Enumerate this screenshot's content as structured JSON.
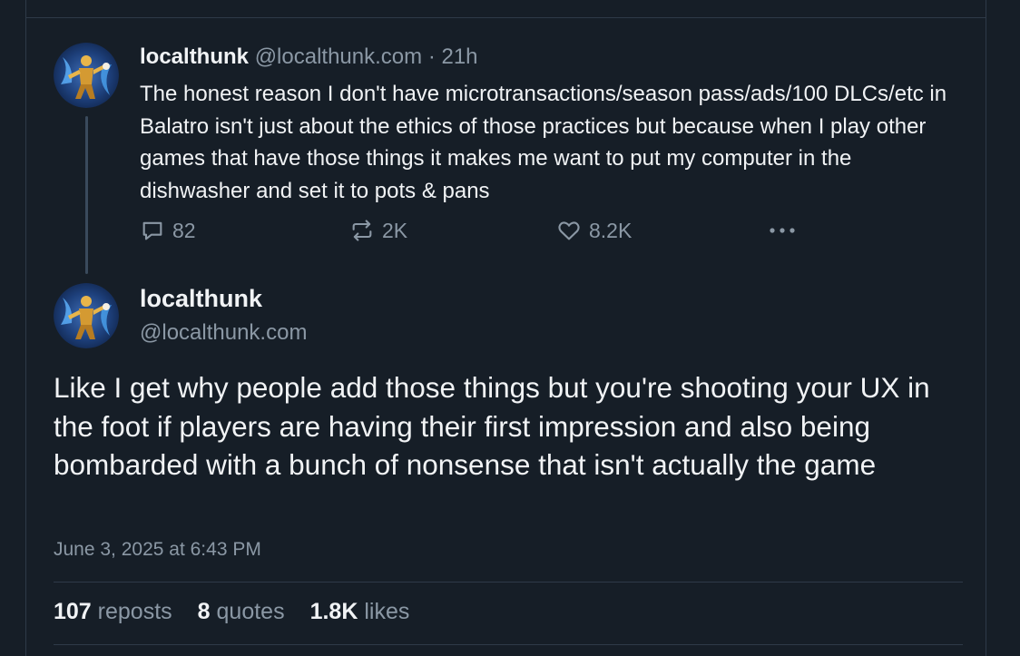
{
  "parent_post": {
    "author_name": "localthunk",
    "author_handle": "@localthunk.com",
    "separator": "·",
    "time_ago": "21h",
    "text": "The honest reason I don't have microtransactions/season pass/ads/100 DLCs/etc in Balatro isn't just about the ethics of those practices but because when I play other games that have those things it makes me want to put my computer in the dishwasher and set it to pots & pans",
    "actions": {
      "replies": "82",
      "reposts": "2K",
      "likes": "8.2K"
    },
    "icons": [
      "comment-icon",
      "repost-icon",
      "heart-icon",
      "more-icon"
    ]
  },
  "main_post": {
    "author_name": "localthunk",
    "author_handle": "@localthunk.com",
    "text": "Like I get why people add those things but you're shooting your UX in the foot if players are having their first impression and also being bombarded with a bunch of nonsense that isn't actually the game",
    "timestamp": "June 3, 2025 at 6:43 PM",
    "stats": {
      "reposts_count": "107",
      "reposts_label": "reposts",
      "quotes_count": "8",
      "quotes_label": "quotes",
      "likes_count": "1.8K",
      "likes_label": "likes"
    }
  },
  "colors": {
    "background": "#161e27",
    "text_primary": "#f1f3f5",
    "text_muted": "#8b98a5",
    "border": "#2e3a48"
  }
}
